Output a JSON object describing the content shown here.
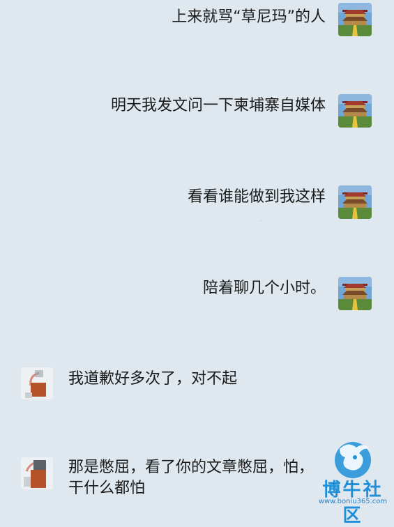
{
  "messages": [
    {
      "side": "right",
      "text": "上来就骂“草尼玛”的人",
      "avatar": "temple-avatar-icon"
    },
    {
      "side": "right",
      "text": "明天我发文问一下柬埔寨自媒体",
      "avatar": "temple-avatar-icon"
    },
    {
      "side": "right",
      "text": "看看谁能做到我这样",
      "avatar": "temple-avatar-icon"
    },
    {
      "side": "right",
      "text": "陪着聊几个小时。",
      "avatar": "temple-avatar-icon"
    },
    {
      "side": "left",
      "text": "我道歉好多次了，对不起",
      "avatar": "blurred-avatar-icon"
    },
    {
      "side": "left",
      "text": "那是憋屈，看了你的文章憋屈，怕，干什么都怕",
      "avatar": "blurred-avatar-icon"
    }
  ],
  "watermark": {
    "title": "博牛社区",
    "url": "www.boniu365.com",
    "logo": "bull-logo-icon"
  },
  "colors": {
    "background": "#dfe8ee",
    "watermark": "#1e8fd8"
  }
}
